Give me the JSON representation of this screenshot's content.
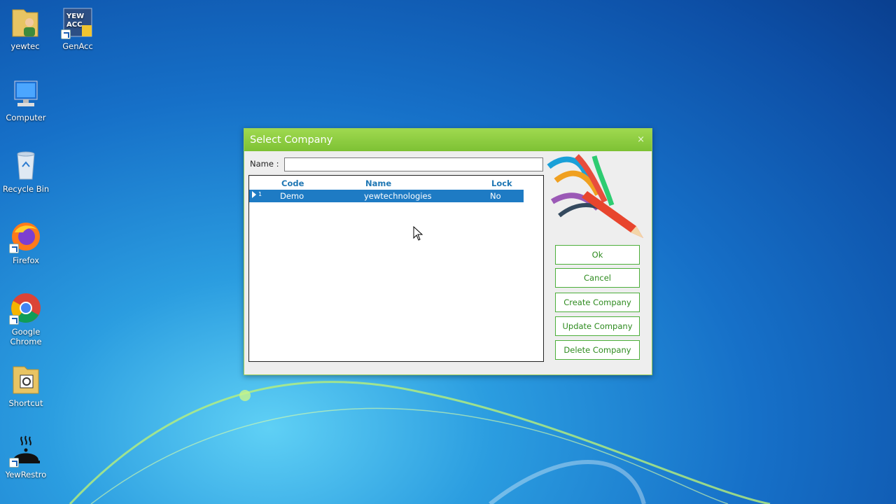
{
  "desktop": {
    "icons": [
      {
        "label": "yewtec",
        "icon": "user-folder-icon"
      },
      {
        "label": "GenAcc",
        "icon": "genacc-app-icon",
        "badge": "YEW ACC"
      },
      {
        "label": "Computer",
        "icon": "computer-icon"
      },
      {
        "label": "Recycle Bin",
        "icon": "recycle-bin-icon"
      },
      {
        "label": "Firefox",
        "icon": "firefox-icon"
      },
      {
        "label": "Google Chrome",
        "icon": "chrome-icon"
      },
      {
        "label": "Shortcut",
        "icon": "shortcut-folder-icon"
      },
      {
        "label": "YewRestro",
        "icon": "restaurant-cloche-icon"
      }
    ]
  },
  "dialog": {
    "title": "Select Company",
    "close_glyph": "×",
    "name_label": "Name :",
    "name_value": "",
    "grid": {
      "columns": [
        "Code",
        "Name",
        "Lock"
      ],
      "rows": [
        {
          "num": "1",
          "code": "Demo",
          "name": "yewtechnologies",
          "lock": "No",
          "selected": true
        }
      ]
    },
    "buttons": {
      "ok": "Ok",
      "cancel": "Cancel",
      "create": "Create Company",
      "update": "Update Company",
      "delete": "Delete Company"
    }
  },
  "colors": {
    "title_bar": "#8ccc42",
    "selected_row": "#1e7bc4",
    "header_text": "#1f77b4",
    "button_border": "#4caf3a"
  }
}
